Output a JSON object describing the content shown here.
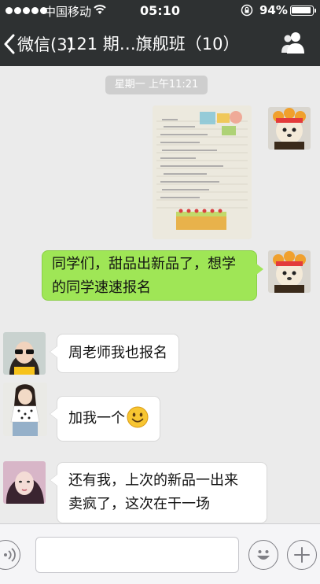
{
  "status_bar": {
    "carrier": "中国移动",
    "time": "05:10",
    "battery_percent": "94%",
    "battery_level": 0.94
  },
  "nav": {
    "back_label": "微信(3)",
    "title": "121 期…旗舰班（10）"
  },
  "chat": {
    "timestamp": "星期一 上午11:21",
    "messages": [
      {
        "sender": "me",
        "type": "image"
      },
      {
        "sender": "me",
        "type": "text",
        "lines": [
          "同学们，甜品出新品了，想学",
          "的同学速速报名"
        ]
      },
      {
        "sender": "other",
        "type": "text",
        "lines": [
          "周老师我也报名"
        ]
      },
      {
        "sender": "other",
        "type": "text",
        "lines": [
          "加我一个"
        ],
        "emoji": "smile-emoji"
      },
      {
        "sender": "other",
        "type": "text",
        "lines": [
          "还有我，上次的新品一出来",
          "卖疯了，这次在干一场"
        ]
      }
    ]
  },
  "colors": {
    "nav_background": "#2e3132",
    "chat_background": "#ebebeb",
    "my_bubble": "#9fe656",
    "their_bubble": "#ffffff"
  },
  "icons": {
    "back": "chevron-left-icon",
    "group": "people-icon",
    "voice": "voice-icon",
    "emoji": "emoji-icon",
    "more": "plus-icon"
  }
}
